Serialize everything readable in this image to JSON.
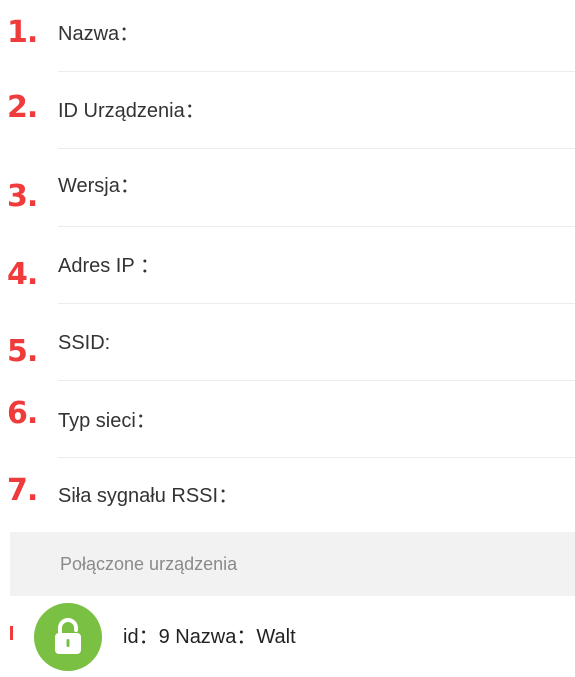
{
  "fields": [
    {
      "number": "1.",
      "label": "Nazwa："
    },
    {
      "number": "2.",
      "label": "ID Urządzenia："
    },
    {
      "number": "3.",
      "label": "Wersja："
    },
    {
      "number": "4.",
      "label": "Adres IP ："
    },
    {
      "number": "5.",
      "label": "SSID:"
    },
    {
      "number": "6.",
      "label": "Typ sieci："
    },
    {
      "number": "7.",
      "label": "Siła sygnału RSSI："
    }
  ],
  "connected": {
    "title": "Połączone urządzenia",
    "device": {
      "text": "id：9 Nazwa：Walt",
      "icon": "lock-icon"
    }
  },
  "colors": {
    "number": "#ef3b3b",
    "icon_bg": "#79c043",
    "section_bg": "#f2f2f2"
  }
}
